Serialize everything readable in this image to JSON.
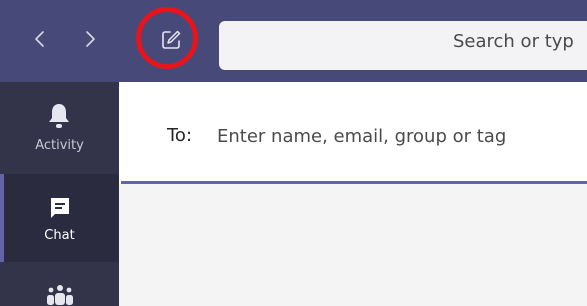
{
  "titlebar": {
    "back_icon": "chevron-left-icon",
    "forward_icon": "chevron-right-icon",
    "compose_icon": "compose-icon",
    "search_placeholder": "Search or typ",
    "highlight_color": "#e8141c",
    "background_color": "#474a78"
  },
  "rail": {
    "items": [
      {
        "label": "Activity",
        "icon": "bell-icon",
        "active": false
      },
      {
        "label": "Chat",
        "icon": "chat-icon",
        "active": true
      },
      {
        "label": "",
        "icon": "teams-icon",
        "active": false
      }
    ],
    "accent_color": "#6264a7"
  },
  "compose": {
    "to_label": "To:",
    "to_placeholder": "Enter name, email, group or tag"
  }
}
